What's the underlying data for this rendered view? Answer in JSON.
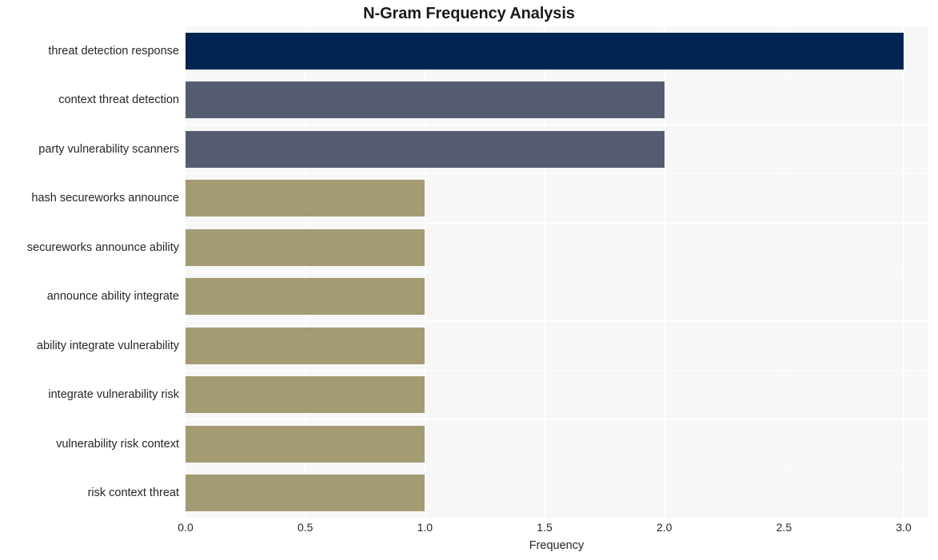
{
  "chart_data": {
    "type": "bar",
    "orientation": "horizontal",
    "title": "N-Gram Frequency Analysis",
    "xlabel": "Frequency",
    "ylabel": "",
    "categories": [
      "threat detection response",
      "context threat detection",
      "party vulnerability scanners",
      "hash secureworks announce",
      "secureworks announce ability",
      "announce ability integrate",
      "ability integrate vulnerability",
      "integrate vulnerability risk",
      "vulnerability risk context",
      "risk context threat"
    ],
    "values": [
      3,
      2,
      2,
      1,
      1,
      1,
      1,
      1,
      1,
      1
    ],
    "bar_colors": [
      "#022450",
      "#565c70",
      "#565c70",
      "#a49b72",
      "#a49b72",
      "#a49b72",
      "#a49b72",
      "#a49b72",
      "#a49b72",
      "#a49b72"
    ],
    "xlim": [
      0,
      3.1
    ],
    "x_ticks": [
      0,
      0.5,
      1,
      1.5,
      2,
      2.5,
      3
    ],
    "x_tick_labels": [
      "0.0",
      "0.5",
      "1.0",
      "1.5",
      "2.0",
      "2.5",
      "3.0"
    ],
    "grid": true,
    "grid_color": "#ffffff",
    "plot_background": "#f7f7f7",
    "figure_background": "#ffffff",
    "legend": null,
    "legend_position": "none"
  }
}
